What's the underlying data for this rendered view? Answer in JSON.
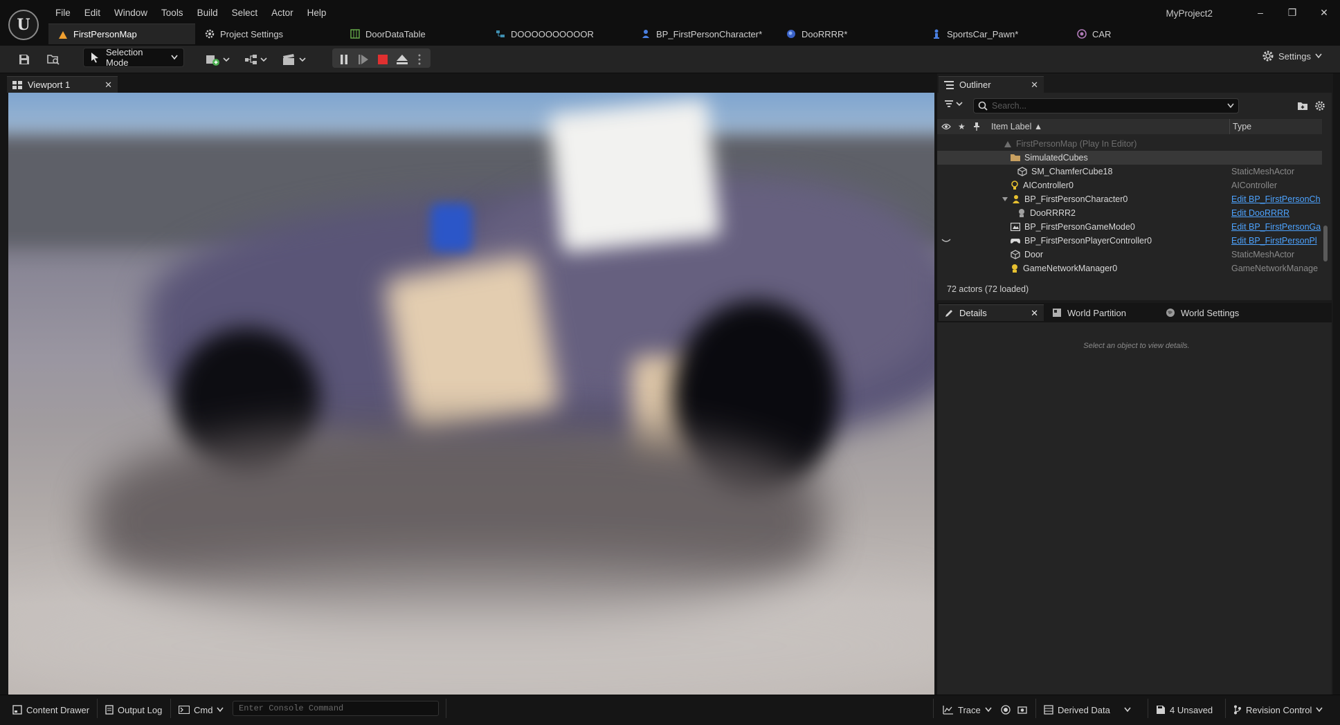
{
  "app": {
    "logo": "U",
    "project_name": "MyProject2",
    "menu": [
      "File",
      "Edit",
      "Window",
      "Tools",
      "Build",
      "Select",
      "Actor",
      "Help"
    ],
    "window_controls": {
      "minimize": "–",
      "maximize": "❐",
      "close": "✕"
    }
  },
  "doctabs": [
    {
      "label": "FirstPersonMap",
      "icon": "level-icon",
      "active": true
    },
    {
      "label": "Project Settings",
      "icon": "settings-cog-icon"
    },
    {
      "label": "DoorDataTable",
      "icon": "datatable-icon"
    },
    {
      "label": "DOOOOOOOOOOR",
      "icon": "struct-icon"
    },
    {
      "label": "BP_FirstPersonCharacter*",
      "icon": "character-icon"
    },
    {
      "label": "DooRRRR*",
      "icon": "blueprint-icon"
    },
    {
      "label": "SportsCar_Pawn*",
      "icon": "pawn-icon"
    },
    {
      "label": "CAR",
      "icon": "material-icon"
    }
  ],
  "toolbar": {
    "mode_label": "Selection Mode",
    "settings_label": "Settings"
  },
  "viewport": {
    "tab_label": "Viewport 1"
  },
  "outliner": {
    "tab_label": "Outliner",
    "search_placeholder": "Search...",
    "col_label": "Item Label ▲",
    "col_type": "Type",
    "rows": [
      {
        "label": "FirstPersonMap (Play In Editor)",
        "type": "",
        "icon": "world-icon"
      },
      {
        "label": "SimulatedCubes",
        "type": "",
        "icon": "folder-icon"
      },
      {
        "label": "SM_ChamferCube18",
        "type": "StaticMeshActor",
        "icon": "static-mesh-icon"
      },
      {
        "label": "AIController0",
        "type": "AIController",
        "icon": "ai-controller-icon"
      },
      {
        "label": "BP_FirstPersonCharacter0",
        "type": "Edit BP_FirstPersonCh",
        "icon": "character-icon"
      },
      {
        "label": "DooRRRR2",
        "type": "Edit DooRRRR",
        "icon": "actor-icon"
      },
      {
        "label": "BP_FirstPersonGameMode0",
        "type": "Edit BP_FirstPersonGa",
        "icon": "gamemode-icon"
      },
      {
        "label": "BP_FirstPersonPlayerController0",
        "type": "Edit BP_FirstPersonPl",
        "icon": "gamepad-icon"
      },
      {
        "label": "Door",
        "type": "StaticMeshActor",
        "icon": "static-mesh-icon"
      },
      {
        "label": "GameNetworkManager0",
        "type": "GameNetworkManage",
        "icon": "network-icon"
      }
    ],
    "count_label": "72 actors (72 loaded)"
  },
  "details": {
    "tabs": [
      "Details",
      "World Partition",
      "World Settings"
    ],
    "empty_message": "Select an object to view details."
  },
  "statusbar": {
    "content_drawer": "Content Drawer",
    "output_log": "Output Log",
    "cmd": "Cmd",
    "console_placeholder": "Enter Console Command",
    "trace": "Trace",
    "derived_data": "Derived Data",
    "unsaved": "4 Unsaved",
    "revision_control": "Revision Control"
  },
  "colors": {
    "accent_orange": "#f0a030",
    "link_blue": "#4da3ff",
    "stop_red": "#e03030"
  }
}
